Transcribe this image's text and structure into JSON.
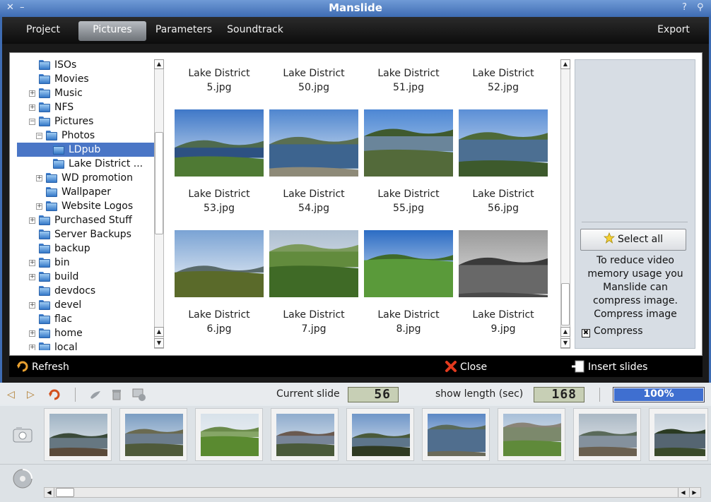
{
  "window": {
    "title": "Manslide",
    "close_glyph": "✕",
    "min_glyph": "–",
    "help_glyph": "?",
    "pin_glyph": "⚲"
  },
  "tabs": [
    {
      "label": "Project"
    },
    {
      "label": "Pictures",
      "active": true
    },
    {
      "label": "Parameters"
    },
    {
      "label": "Soundtrack"
    },
    {
      "label": "Export"
    }
  ],
  "tree": [
    {
      "label": "ISOs",
      "expander": "",
      "indent": 0
    },
    {
      "label": "Movies",
      "expander": "",
      "indent": 0
    },
    {
      "label": "Music",
      "expander": "+",
      "indent": 0
    },
    {
      "label": "NFS",
      "expander": "+",
      "indent": 0
    },
    {
      "label": "Pictures",
      "expander": "−",
      "indent": 0
    },
    {
      "label": "Photos",
      "expander": "−",
      "indent": 1
    },
    {
      "label": "LDpub",
      "expander": "",
      "indent": 2,
      "selected": true
    },
    {
      "label": "Lake District ...",
      "expander": "",
      "indent": 2
    },
    {
      "label": "WD promotion",
      "expander": "+",
      "indent": 1
    },
    {
      "label": "Wallpaper",
      "expander": "",
      "indent": 1
    },
    {
      "label": "Website Logos",
      "expander": "+",
      "indent": 1
    },
    {
      "label": "Purchased Stuff",
      "expander": "+",
      "indent": 0
    },
    {
      "label": "Server Backups",
      "expander": "",
      "indent": 0
    },
    {
      "label": "backup",
      "expander": "",
      "indent": 0
    },
    {
      "label": "bin",
      "expander": "+",
      "indent": 0
    },
    {
      "label": "build",
      "expander": "+",
      "indent": 0
    },
    {
      "label": "devdocs",
      "expander": "",
      "indent": 0
    },
    {
      "label": "devel",
      "expander": "+",
      "indent": 0
    },
    {
      "label": "flac",
      "expander": "",
      "indent": 0
    },
    {
      "label": "home",
      "expander": "+",
      "indent": 0
    },
    {
      "label": "local",
      "expander": "+",
      "indent": 0
    }
  ],
  "images": [
    {
      "line1": "Lake District",
      "line2": "5.jpg",
      "thumb": "none"
    },
    {
      "line1": "Lake District",
      "line2": "50.jpg",
      "thumb": "none"
    },
    {
      "line1": "Lake District",
      "line2": "51.jpg",
      "thumb": "none"
    },
    {
      "line1": "Lake District",
      "line2": "52.jpg",
      "thumb": "none"
    },
    {
      "line1": "Lake District",
      "line2": "53.jpg",
      "thumb": "lake-hill"
    },
    {
      "line1": "Lake District",
      "line2": "54.jpg",
      "thumb": "lake-wide"
    },
    {
      "line1": "Lake District",
      "line2": "55.jpg",
      "thumb": "lake-forest"
    },
    {
      "line1": "Lake District",
      "line2": "56.jpg",
      "thumb": "lake-forest2"
    },
    {
      "line1": "Lake District",
      "line2": "6.jpg",
      "thumb": "moor-lake"
    },
    {
      "line1": "Lake District",
      "line2": "7.jpg",
      "thumb": "green-hills"
    },
    {
      "line1": "Lake District",
      "line2": "8.jpg",
      "thumb": "green-field"
    },
    {
      "line1": "Lake District",
      "line2": "9.jpg",
      "thumb": "grey-lake"
    }
  ],
  "side": {
    "select_all": "Select all",
    "info": "To reduce video memory usage you Manslide can compress image. Compress image",
    "compress_label": "Compress",
    "compress_checked": "✖"
  },
  "actions": {
    "refresh": "Refresh",
    "close": "Close",
    "insert": "Insert slides"
  },
  "status": {
    "current_slide_label": "Current slide",
    "current_slide": "56",
    "show_length_label": "show length (sec)",
    "show_length": "168",
    "progress_text": "100%",
    "progress": 1.0
  },
  "toolbar_icons": {
    "prev": "◁",
    "next": "▷"
  },
  "filmstrip": [
    "dock",
    "reeds-hill",
    "tree-field",
    "hill-lake",
    "tree-lake",
    "calm-lake",
    "rocky-hill",
    "lake-shore",
    "dark-trees"
  ]
}
